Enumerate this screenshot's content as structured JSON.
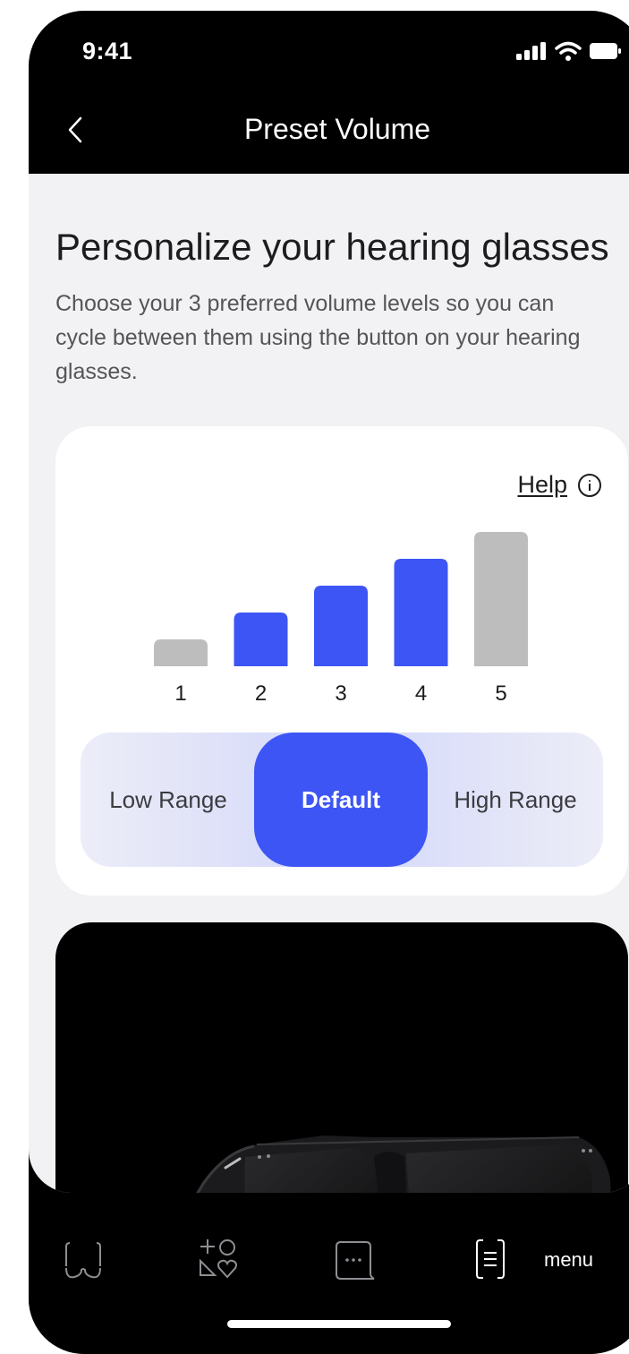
{
  "status_bar": {
    "time": "9:41"
  },
  "header": {
    "title": "Preset Volume"
  },
  "main": {
    "headline": "Personalize your hearing glasses",
    "description": "Choose your 3 preferred volume levels so you can cycle between them using the button on your hearing glasses."
  },
  "card": {
    "help_label": "Help",
    "range_options": [
      {
        "label": "Low Range",
        "selected": false
      },
      {
        "label": "Default",
        "selected": true
      },
      {
        "label": "High Range",
        "selected": false
      }
    ]
  },
  "chart_data": {
    "type": "bar",
    "categories": [
      "1",
      "2",
      "3",
      "4",
      "5"
    ],
    "values": [
      1,
      2,
      3,
      4,
      5
    ],
    "selected": [
      false,
      true,
      true,
      true,
      false
    ],
    "ylim": [
      0,
      5
    ],
    "colors": {
      "selected": "#3d55f5",
      "unselected": "#bdbdbd"
    }
  },
  "tab_bar": {
    "menu_label": "menu"
  },
  "colors": {
    "accent": "#3d55f5",
    "background": "#f2f2f4",
    "card": "#ffffff",
    "dark": "#000000"
  },
  "icons": [
    "back-chevron-icon",
    "signal-icon",
    "wifi-icon",
    "battery-icon",
    "info-icon",
    "glasses-icon",
    "add-favorites-icon",
    "chat-icon",
    "menu-icon"
  ]
}
